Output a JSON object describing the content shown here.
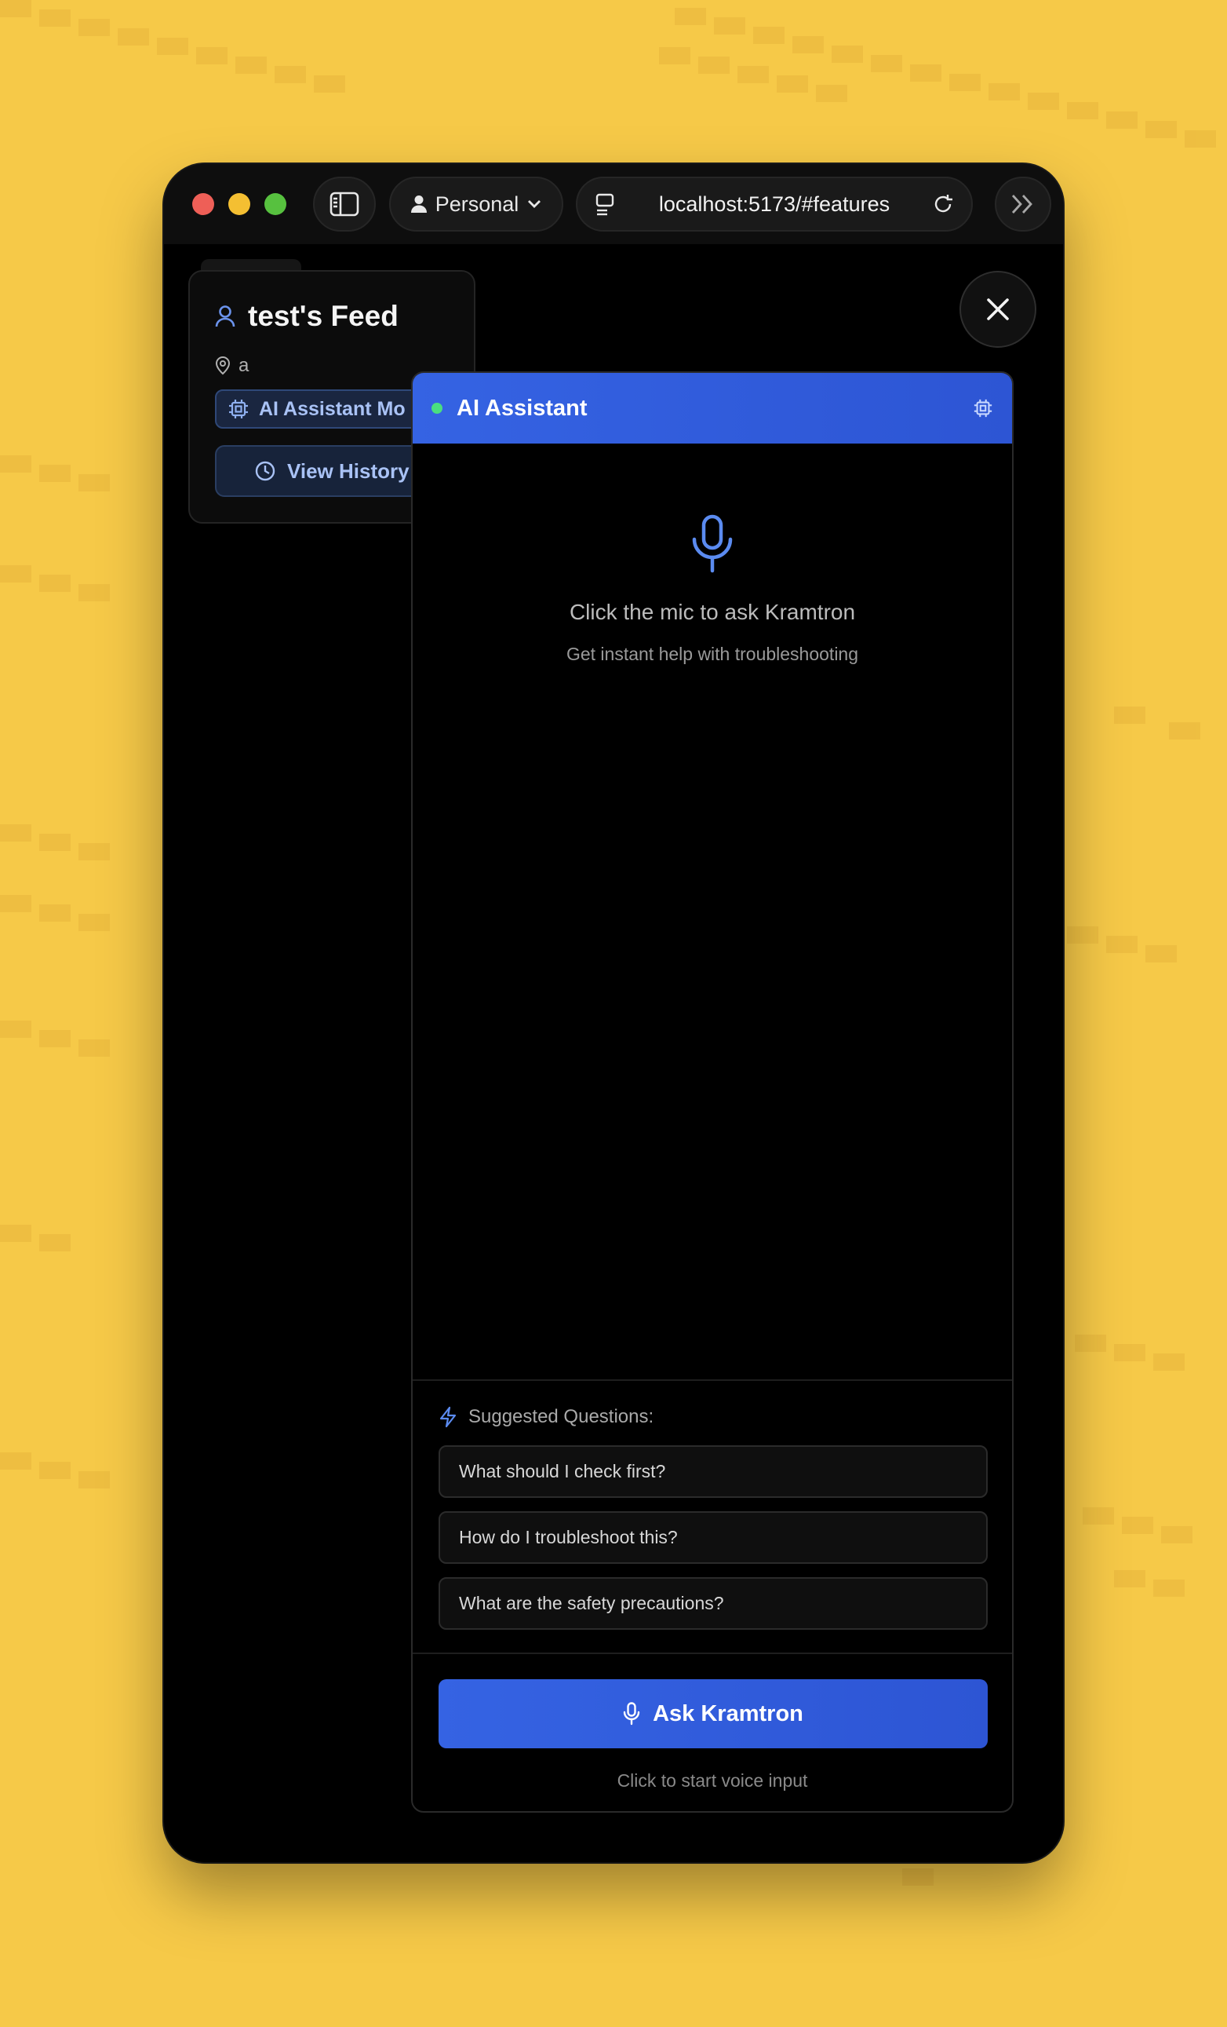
{
  "browser": {
    "profile_label": "Personal",
    "url": "localhost:5173/#features"
  },
  "feed": {
    "title": "test's Feed",
    "location": "a",
    "ai_mode_label": "AI Assistant Mo",
    "view_history_label": "View History"
  },
  "assistant": {
    "title": "AI Assistant",
    "status": "online",
    "empty_title": "Click the mic to ask Kramtron",
    "empty_subtitle": "Get instant help with troubleshooting",
    "suggested_label": "Suggested Questions:",
    "suggestions": [
      "What should I check first?",
      "How do I troubleshoot this?",
      "What are the safety precautions?"
    ],
    "ask_button_label": "Ask Kramtron",
    "ask_hint": "Click to start voice input"
  },
  "colors": {
    "background": "#f6c948",
    "accent": "#3563e3",
    "status_online": "#4ade80"
  }
}
